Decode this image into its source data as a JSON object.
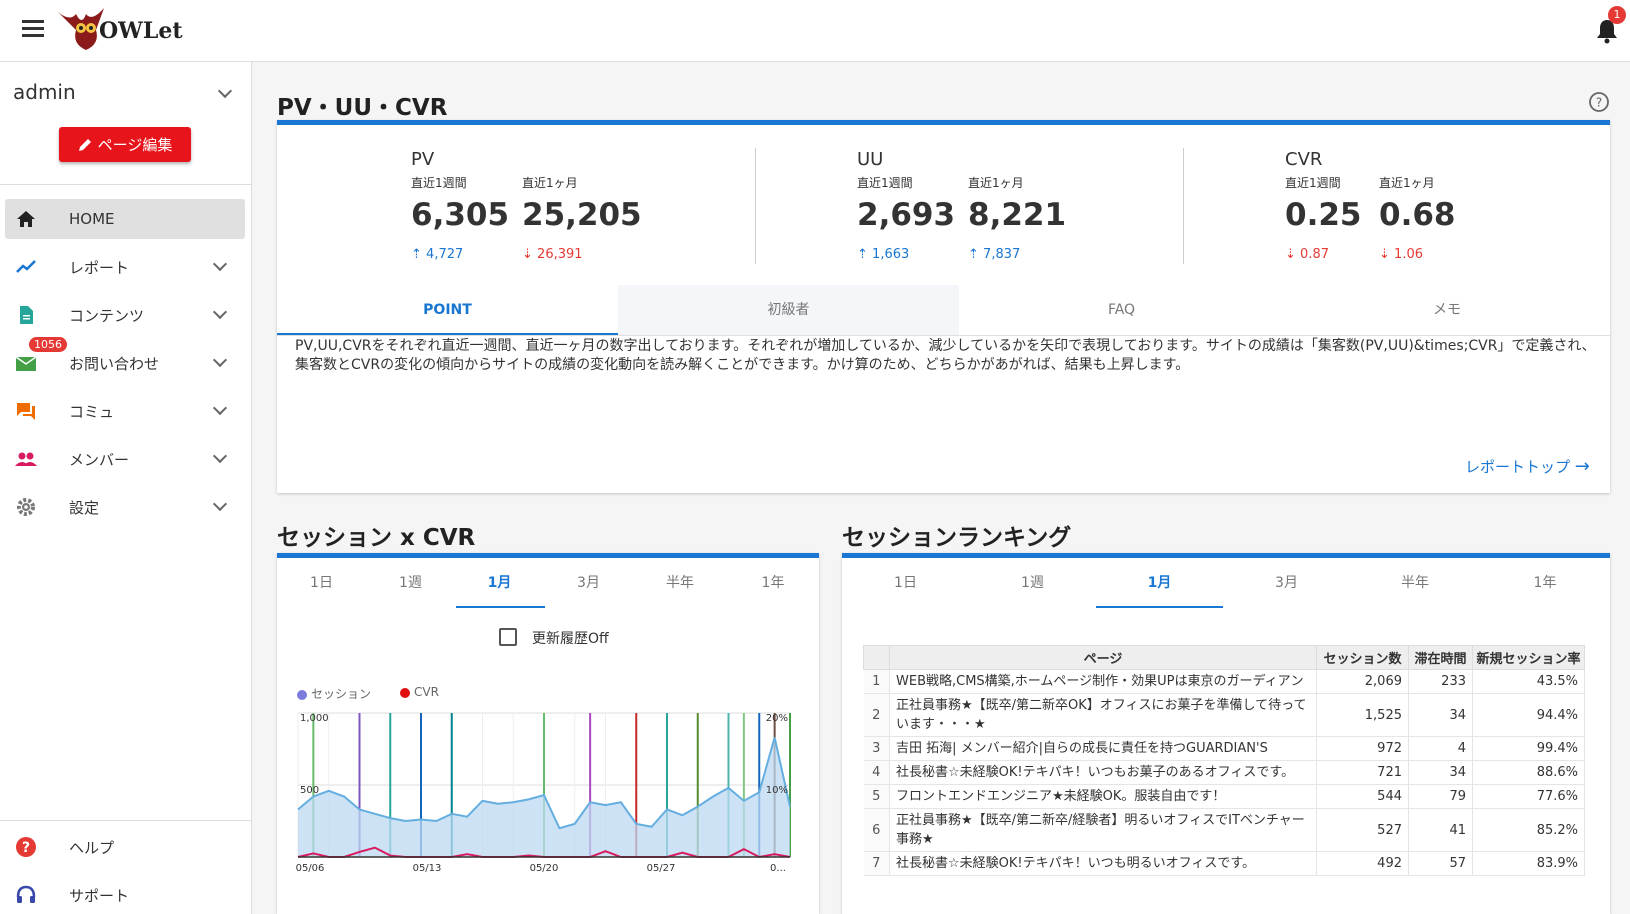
{
  "app": {
    "logo_text": "OWLet",
    "notification_count": "1"
  },
  "sidebar": {
    "user": "admin",
    "edit_button": "ページ編集",
    "items": [
      {
        "label": "HOME",
        "icon": "home-icon",
        "color": "#222222"
      },
      {
        "label": "レポート",
        "icon": "trending-icon",
        "color": "#1976d2"
      },
      {
        "label": "コンテンツ",
        "icon": "document-icon",
        "color": "#26a69a"
      },
      {
        "label": "お問い合わせ",
        "icon": "mail-icon",
        "color": "#43a047",
        "badge": "1056"
      },
      {
        "label": "コミュ",
        "icon": "chat-icon",
        "color": "#ef6c00"
      },
      {
        "label": "メンバー",
        "icon": "people-icon",
        "color": "#d81b60"
      },
      {
        "label": "設定",
        "icon": "gear-icon",
        "color": "#777777"
      }
    ],
    "bottom": [
      {
        "label": "ヘルプ",
        "icon": "help-icon",
        "color": "#e53935"
      },
      {
        "label": "サポート",
        "icon": "headset-icon",
        "color": "#3949ab"
      }
    ]
  },
  "pv_section": {
    "title": "PV・UU・CVR",
    "metrics": [
      {
        "name": "PV",
        "week_label": "直近1週間",
        "month_label": "直近1ヶ月",
        "week": "6,305",
        "month": "25,205",
        "week_delta": "4,727",
        "week_dir": "up",
        "month_delta": "26,391",
        "month_dir": "down"
      },
      {
        "name": "UU",
        "week_label": "直近1週間",
        "month_label": "直近1ヶ月",
        "week": "2,693",
        "month": "8,221",
        "week_delta": "1,663",
        "week_dir": "up",
        "month_delta": "7,837",
        "month_dir": "up"
      },
      {
        "name": "CVR",
        "week_label": "直近1週間",
        "month_label": "直近1ヶ月",
        "week": "0.25",
        "month": "0.68",
        "week_delta": "0.87",
        "week_dir": "down",
        "month_delta": "1.06",
        "month_dir": "down"
      }
    ],
    "tabs": [
      "POINT",
      "初級者",
      "FAQ",
      "メモ"
    ],
    "point_text": "PV,UU,CVRをそれぞれ直近一週間、直近一ヶ月の数字出しております。それぞれが増加しているか、減少しているかを矢印で表現しております。サイトの成績は「集客数(PV,UU)&times;CVR」で定義され、集客数とCVRの変化の傾向からサイトの成績の変化動向を読み解くことができます。かけ算のため、どちらかがあがれば、結果も上昇します。",
    "report_link": "レポートトップ"
  },
  "session_cvr": {
    "title": "セッション x CVR",
    "tabs": [
      "1日",
      "1週",
      "1月",
      "3月",
      "半年",
      "1年"
    ],
    "checkbox_label": "更新履歴Off",
    "legend": [
      {
        "name": "セッション",
        "color": "#7b7bdd"
      },
      {
        "name": "CVR",
        "color": "#e01010"
      }
    ],
    "chart_data": {
      "type": "area",
      "x_ticks": [
        "05/06",
        "05/13",
        "05/20",
        "05/27",
        "0..."
      ],
      "y_ticks_left": [
        "1,000",
        "500"
      ],
      "y_ticks_right": [
        "20%",
        "10%"
      ],
      "sessions": [
        330,
        420,
        460,
        420,
        330,
        300,
        270,
        250,
        260,
        250,
        300,
        280,
        390,
        370,
        380,
        400,
        430,
        200,
        230,
        380,
        360,
        380,
        230,
        210,
        330,
        290,
        350,
        420,
        480,
        390,
        450,
        830,
        350
      ],
      "cvr": [
        0,
        0.5,
        0,
        0,
        0.7,
        1.3,
        0.2,
        0,
        0,
        0,
        0,
        0.4,
        0,
        0,
        0,
        0.2,
        0,
        0,
        0,
        0,
        0.8,
        0,
        0,
        0,
        0,
        0.6,
        0,
        0,
        0,
        1.1,
        0,
        0.4,
        0
      ],
      "ylim_left": [
        0,
        1000
      ],
      "ylim_right": [
        0,
        20
      ]
    }
  },
  "ranking": {
    "title": "セッションランキング",
    "tabs": [
      "1日",
      "1週",
      "1月",
      "3月",
      "半年",
      "1年"
    ],
    "columns": [
      "ページ",
      "セッション数",
      "滞在時間",
      "新規セッション率"
    ],
    "rows": [
      {
        "idx": "1",
        "page": "WEB戦略,CMS構築,ホームページ制作・効果UPは東京のガーディアン",
        "sessions": "2,069",
        "time": "233",
        "rate": "43.5%"
      },
      {
        "idx": "2",
        "page": "正社員事務★【既卒/第二新卒OK】オフィスにお菓子を準備して待っています・・・★",
        "sessions": "1,525",
        "time": "34",
        "rate": "94.4%"
      },
      {
        "idx": "3",
        "page": "吉田 拓海| メンバー紹介|自らの成長に責任を持つGUARDIAN'S",
        "sessions": "972",
        "time": "4",
        "rate": "99.4%"
      },
      {
        "idx": "4",
        "page": "社長秘書☆未経験OK!テキパキ！いつもお菓子のあるオフィスです。",
        "sessions": "721",
        "time": "34",
        "rate": "88.6%"
      },
      {
        "idx": "5",
        "page": "フロントエンドエンジニア★未経験OK。服装自由です！",
        "sessions": "544",
        "time": "79",
        "rate": "77.6%"
      },
      {
        "idx": "6",
        "page": "正社員事務★【既卒/第二新卒/経験者】明るいオフィスでITベンチャー事務★",
        "sessions": "527",
        "time": "41",
        "rate": "85.2%"
      },
      {
        "idx": "7",
        "page": "社長秘書☆未経験OK!テキパキ！いつも明るいオフィスです。",
        "sessions": "492",
        "time": "57",
        "rate": "83.9%"
      }
    ]
  }
}
